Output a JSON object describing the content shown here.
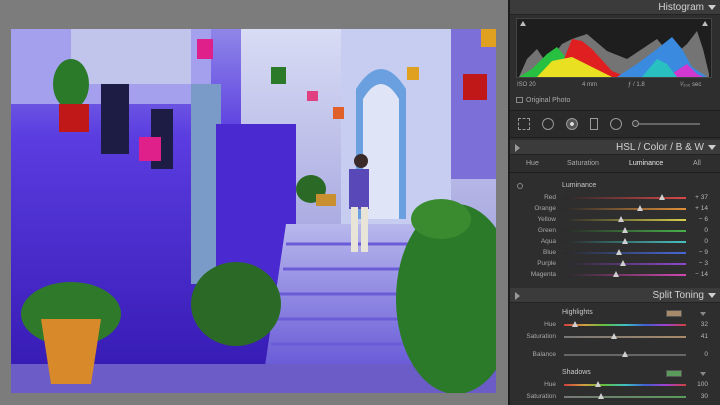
{
  "histogram": {
    "title": "Histogram",
    "exif": {
      "iso": "ISO 20",
      "focal": "4 mm",
      "aperture": "ƒ / 1.8",
      "shutter": "¹⁄₂₀₀ sec"
    },
    "original_photo_label": "Original Photo"
  },
  "hsl": {
    "title": "HSL / Color / B & W",
    "tabs": [
      "Hue",
      "Saturation",
      "Luminance",
      "All"
    ],
    "active_tab": "Luminance",
    "group_label": "Luminance",
    "rows": [
      {
        "label": "Red",
        "value": "+ 37",
        "fraction": 0.8,
        "color": "#d84848"
      },
      {
        "label": "Orange",
        "value": "+ 14",
        "fraction": 0.62,
        "color": "#e0903a"
      },
      {
        "label": "Yellow",
        "value": "− 6",
        "fraction": 0.47,
        "color": "#d8d04a"
      },
      {
        "label": "Green",
        "value": "0",
        "fraction": 0.5,
        "color": "#48b048"
      },
      {
        "label": "Aqua",
        "value": "0",
        "fraction": 0.5,
        "color": "#48c0c0"
      },
      {
        "label": "Blue",
        "value": "− 9",
        "fraction": 0.45,
        "color": "#4868d8"
      },
      {
        "label": "Purple",
        "value": "− 3",
        "fraction": 0.48,
        "color": "#9048d0"
      },
      {
        "label": "Magenta",
        "value": "− 14",
        "fraction": 0.43,
        "color": "#d048b0"
      }
    ]
  },
  "split_toning": {
    "title": "Split Toning",
    "highlights": {
      "label": "Highlights",
      "swatch": "#a88a6a",
      "hue_label": "Hue",
      "hue_value": "32",
      "hue_fraction": 0.09,
      "sat_label": "Saturation",
      "sat_value": "41",
      "sat_fraction": 0.41
    },
    "balance": {
      "label": "Balance",
      "value": "0",
      "fraction": 0.5
    },
    "shadows": {
      "label": "Shadows",
      "swatch": "#5a9a5a",
      "hue_label": "Hue",
      "hue_value": "100",
      "hue_fraction": 0.28,
      "sat_label": "Saturation",
      "sat_value": "30",
      "sat_fraction": 0.3
    }
  },
  "colors": {
    "panel_bg": "#2e2e2e",
    "header_bg": "#3b3b3b",
    "canvas_bg": "#7c7c7c"
  }
}
